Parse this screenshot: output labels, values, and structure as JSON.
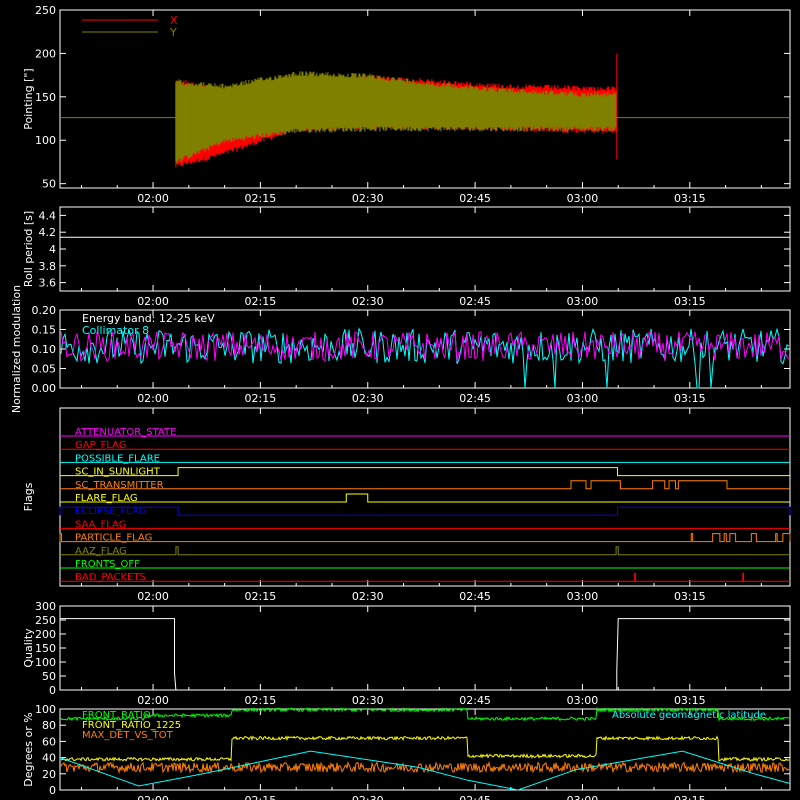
{
  "chart_data": [
    {
      "id": "pointing",
      "type": "line",
      "ylabel": "Pointing [\"]",
      "ylim": [
        45,
        250
      ],
      "yticks": [
        50,
        100,
        150,
        200,
        250
      ],
      "xlim_min": [
        107,
        209
      ],
      "x_ticks": [
        "02:00",
        "02:15",
        "02:30",
        "02:45",
        "03:00",
        "03:15"
      ],
      "x_tick_min": [
        120,
        135,
        150,
        165,
        180,
        195
      ],
      "legend": [
        "X",
        "Y"
      ],
      "legend_position": "top-left",
      "colors": {
        "X": "#ff0000",
        "Y": "#808000",
        "center": "#808000"
      },
      "series": [
        {
          "name": "X",
          "t_start": 123.2,
          "t_end": 184.8,
          "envelope_min": [
            123.2,
            130,
            140,
            150,
            160,
            170,
            180,
            184.8
          ],
          "upper": [
            172,
            160,
            168,
            176,
            170,
            165,
            163,
            162
          ],
          "lower": [
            67,
            82,
            110,
            112,
            112,
            110,
            108,
            108
          ]
        },
        {
          "name": "Y",
          "t_start": 123.2,
          "t_end": 184.8,
          "envelope_min": [
            123.2,
            130,
            140,
            150,
            160,
            170,
            180,
            184.8
          ],
          "upper": [
            170,
            165,
            180,
            177,
            167,
            160,
            156,
            156
          ],
          "lower": [
            72,
            96,
            108,
            110,
            110,
            110,
            110,
            110
          ]
        }
      ],
      "center_level": 126
    },
    {
      "id": "roll",
      "type": "line",
      "ylabel": "Roll period [s]",
      "ylim": [
        3.5,
        4.5
      ],
      "yticks": [
        3.6,
        3.8,
        4.0,
        4.2,
        4.4
      ],
      "x_ticks": [
        "02:00",
        "02:15",
        "02:30",
        "02:45",
        "03:00",
        "03:15"
      ],
      "series": [
        {
          "name": "",
          "t_start": 107,
          "t_end": 209,
          "value": 4.14
        }
      ]
    },
    {
      "id": "modulation",
      "type": "line",
      "ylabel": "Normalized modulation",
      "ylim": [
        0,
        0.2
      ],
      "yticks": [
        0.0,
        0.05,
        0.1,
        0.15,
        0.2
      ],
      "ytick_labels": [
        "0.00",
        "0.05",
        "0.10",
        "0.15",
        "0.20"
      ],
      "x_ticks": [
        "02:00",
        "02:15",
        "02:30",
        "02:45",
        "03:00",
        "03:15"
      ],
      "annotation": "Energy band: 12-25 keV",
      "legend": [
        "Collimator 8"
      ],
      "series": [
        {
          "name": "",
          "color": "#00ffff",
          "mean": 0.107,
          "spread": 0.045,
          "dropouts_min": [
            [
              171.8,
              172.0
            ],
            [
              176.0,
              176.2
            ],
            [
              183.4,
              183.6
            ],
            [
              196.0,
              196.3
            ],
            [
              197.8,
              198.0
            ]
          ]
        },
        {
          "name": "",
          "color": "#ff00ff",
          "mean": 0.107,
          "spread": 0.038
        }
      ]
    },
    {
      "id": "flags",
      "type": "line",
      "ylabel": "Flags",
      "x_ticks": [
        "02:00",
        "02:15",
        "02:30",
        "02:45",
        "03:00",
        "03:15"
      ],
      "flags": [
        {
          "name": "ATTENUATOR_STATE",
          "color": "#ff00ff",
          "on": []
        },
        {
          "name": "GAP_FLAG",
          "color": "#ff0000",
          "on": []
        },
        {
          "name": "POSSIBLE_FLARE",
          "color": "#00ffff",
          "on": []
        },
        {
          "name": "SC_IN_SUNLIGHT",
          "color": "#ffff00",
          "on": [
            [
              123.5,
              184.9
            ]
          ]
        },
        {
          "name": "SC_TRANSMITTER",
          "color": "#ff8000",
          "on": [
            [
              178.4,
              180.5
            ],
            [
              181.2,
              185.3
            ],
            [
              189.8,
              191.5
            ],
            [
              192.1,
              193.0
            ],
            [
              193.4,
              200.2
            ]
          ]
        },
        {
          "name": "FLARE_FLAG",
          "color": "#ffff00",
          "on": [
            [
              147.0,
              150.0
            ]
          ]
        },
        {
          "name": "ECLIPSE_FLAG",
          "color": "#0000ff",
          "on": [
            [
              107.0,
              123.5
            ],
            [
              184.9,
              209.0
            ]
          ]
        },
        {
          "name": "SAA_FLAG",
          "color": "#ff0000",
          "on": []
        },
        {
          "name": "PARTICLE_FLAG",
          "color": "#ff8000",
          "on": [
            [
              107.0,
              107.2
            ],
            [
              195.2,
              195.4
            ],
            [
              198.2,
              199.2
            ],
            [
              199.8,
              200.1
            ],
            [
              200.6,
              201.4
            ],
            [
              203.6,
              204.3
            ],
            [
              207.0,
              207.2
            ],
            [
              208.0,
              209.0
            ]
          ]
        },
        {
          "name": "AAZ_FLAG",
          "color": "#808000",
          "on": [
            [
              123.2,
              123.5
            ],
            [
              184.7,
              185.0
            ]
          ]
        },
        {
          "name": "FRONTS_OFF",
          "color": "#00ff00",
          "on": []
        },
        {
          "name": "BAD_PACKETS",
          "color": "#ff0000",
          "on": [
            [
              187.3,
              187.4
            ],
            [
              202.4,
              202.5
            ]
          ]
        }
      ]
    },
    {
      "id": "quality",
      "type": "line",
      "ylabel": "Quality",
      "ylim": [
        0,
        300
      ],
      "yticks": [
        0,
        50,
        100,
        150,
        200,
        250,
        300
      ],
      "x_ticks": [
        "02:00",
        "02:15",
        "02:30",
        "02:45",
        "03:00",
        "03:15"
      ],
      "series": [
        {
          "name": "",
          "points_min": [
            [
              107,
              255
            ],
            [
              123.0,
              255
            ],
            [
              123.0,
              60
            ],
            [
              123.2,
              0
            ],
            [
              184.8,
              0
            ],
            [
              184.8,
              70
            ],
            [
              185.0,
              255
            ],
            [
              209,
              255
            ]
          ]
        }
      ]
    },
    {
      "id": "ratios",
      "type": "line",
      "ylabel": "Degrees or %",
      "ylim": [
        0,
        100
      ],
      "yticks": [
        0,
        20,
        40,
        60,
        80,
        100
      ],
      "x_ticks": [
        "02:00",
        "02:15",
        "02:30",
        "02:45",
        "03:00",
        "03:15"
      ],
      "legend": [
        "FRONT_RATIO",
        "FRONT_RATIO_1225",
        "MAX_DET_VS_TOT"
      ],
      "annotation": "Absolute geomagnetic latitude",
      "series": [
        {
          "name": "FRONT_RATIO",
          "color": "#00ff00",
          "steps_min": [
            [
              107,
              88
            ],
            [
              119,
              92
            ],
            [
              131,
              99
            ],
            [
              164,
              88
            ],
            [
              182,
              99
            ],
            [
              199,
              88
            ],
            [
              209,
              88
            ]
          ]
        },
        {
          "name": "FRONT_RATIO_1225",
          "color": "#ffff00",
          "steps_min": [
            [
              107,
              38
            ],
            [
              131,
              64
            ],
            [
              164,
              42
            ],
            [
              182,
              64
            ],
            [
              199,
              38
            ],
            [
              209,
              38
            ]
          ]
        },
        {
          "name": "MAX_DET_VS_TOT",
          "color": "#ff8000",
          "level": 28
        },
        {
          "name": "Absolute geomagnetic latitude",
          "color": "#00ffff",
          "points_min": [
            [
              107,
              40
            ],
            [
              118,
              5
            ],
            [
              127,
              20
            ],
            [
              142,
              48
            ],
            [
              157,
              28
            ],
            [
              164,
              12
            ],
            [
              171,
              0
            ],
            [
              179,
              25
            ],
            [
              194,
              48
            ],
            [
              204,
              20
            ],
            [
              209,
              8
            ]
          ]
        }
      ]
    }
  ]
}
